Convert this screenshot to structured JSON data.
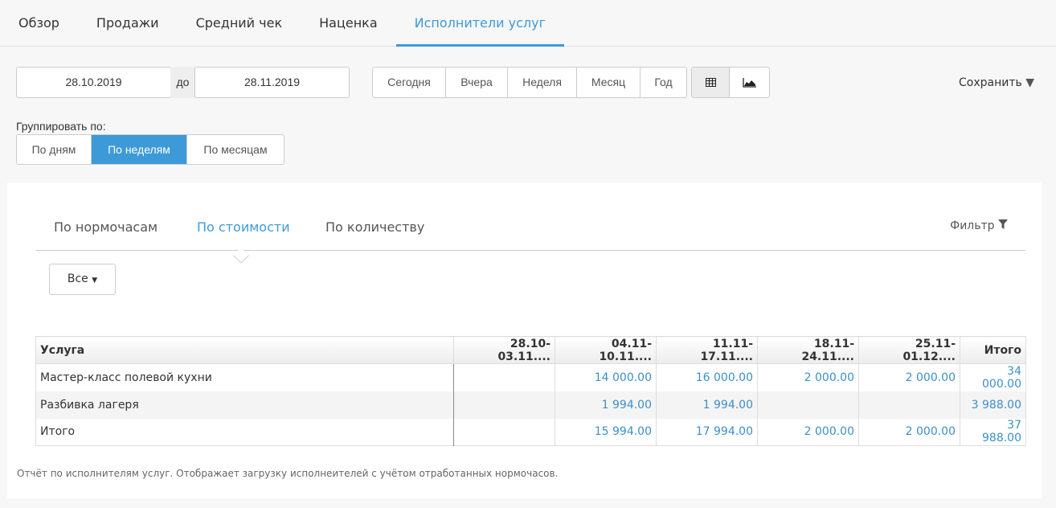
{
  "nav": {
    "tabs": [
      {
        "label": "Обзор"
      },
      {
        "label": "Продажи"
      },
      {
        "label": "Средний чек"
      },
      {
        "label": "Наценка"
      },
      {
        "label": "Исполнители услуг",
        "active": true
      }
    ]
  },
  "dates": {
    "from": "28.10.2019",
    "sep": "до",
    "to": "28.11.2019"
  },
  "periods": [
    "Сегодня",
    "Вчера",
    "Неделя",
    "Месяц",
    "Год"
  ],
  "view": {
    "icons": [
      "table-icon",
      "area-chart-icon"
    ],
    "selected": "table"
  },
  "save_label": "Сохранить",
  "group": {
    "label": "Группировать по:",
    "options": [
      "По дням",
      "По неделям",
      "По месяцам"
    ],
    "selected": 1
  },
  "subtabs": {
    "items": [
      "По нормочасам",
      "По стоимости",
      "По количеству"
    ],
    "active": 1,
    "filter": "Фильтр"
  },
  "all_label": "Все",
  "table": {
    "headers": [
      "Услуга",
      "28.10-03.11....",
      "04.11-10.11....",
      "11.11-17.11....",
      "18.11-24.11....",
      "25.11-01.12....",
      "Итого"
    ],
    "rows": [
      [
        "Мастер-класс полевой кухни",
        "",
        "14 000.00",
        "16 000.00",
        "2 000.00",
        "2 000.00",
        "34 000.00"
      ],
      [
        "Разбивка лагеря",
        "",
        "1 994.00",
        "1 994.00",
        "",
        "",
        "3 988.00"
      ],
      [
        "Итого",
        "",
        "15 994.00",
        "17 994.00",
        "2 000.00",
        "2 000.00",
        "37 988.00"
      ]
    ]
  },
  "note": "Отчёт по исполнителям услуг. Отображает загрузку исполнеителей с учётом отработанных нормочасов.",
  "colors": {
    "accent": "#3d9ad8"
  }
}
